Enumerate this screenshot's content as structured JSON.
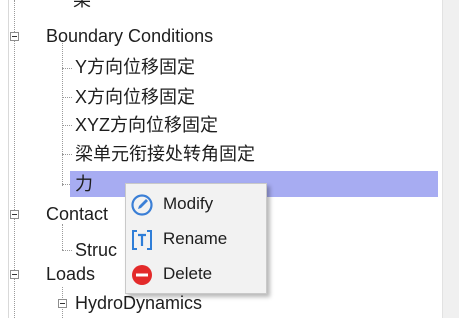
{
  "tree": {
    "nodes": [
      {
        "id": "top-partial",
        "label": "染"
      },
      {
        "id": "boundary-conditions",
        "label": "Boundary Conditions"
      },
      {
        "id": "y-fix",
        "label": "Y方向位移固定"
      },
      {
        "id": "x-fix",
        "label": "X方向位移固定"
      },
      {
        "id": "xyz-fix",
        "label": "XYZ方向位移固定"
      },
      {
        "id": "beam-joint-fix",
        "label": "梁单元衔接处转角固定"
      },
      {
        "id": "force",
        "label": "力"
      },
      {
        "id": "contact",
        "label": "Contact"
      },
      {
        "id": "struct",
        "label": "Struc"
      },
      {
        "id": "loads",
        "label": "Loads"
      },
      {
        "id": "hydrodynamics",
        "label": "HydroDynamics"
      }
    ],
    "selected": "力"
  },
  "context_menu": {
    "items": [
      {
        "label": "Modify",
        "icon": "modify-icon",
        "color": "#3b7fd6"
      },
      {
        "label": "Rename",
        "icon": "rename-icon",
        "color": "#2f7ed8"
      },
      {
        "label": "Delete",
        "icon": "delete-icon",
        "color": "#e32a2a"
      }
    ]
  },
  "colors": {
    "selection": "#a7acf2",
    "menu_bg": "#f2f2f2"
  }
}
